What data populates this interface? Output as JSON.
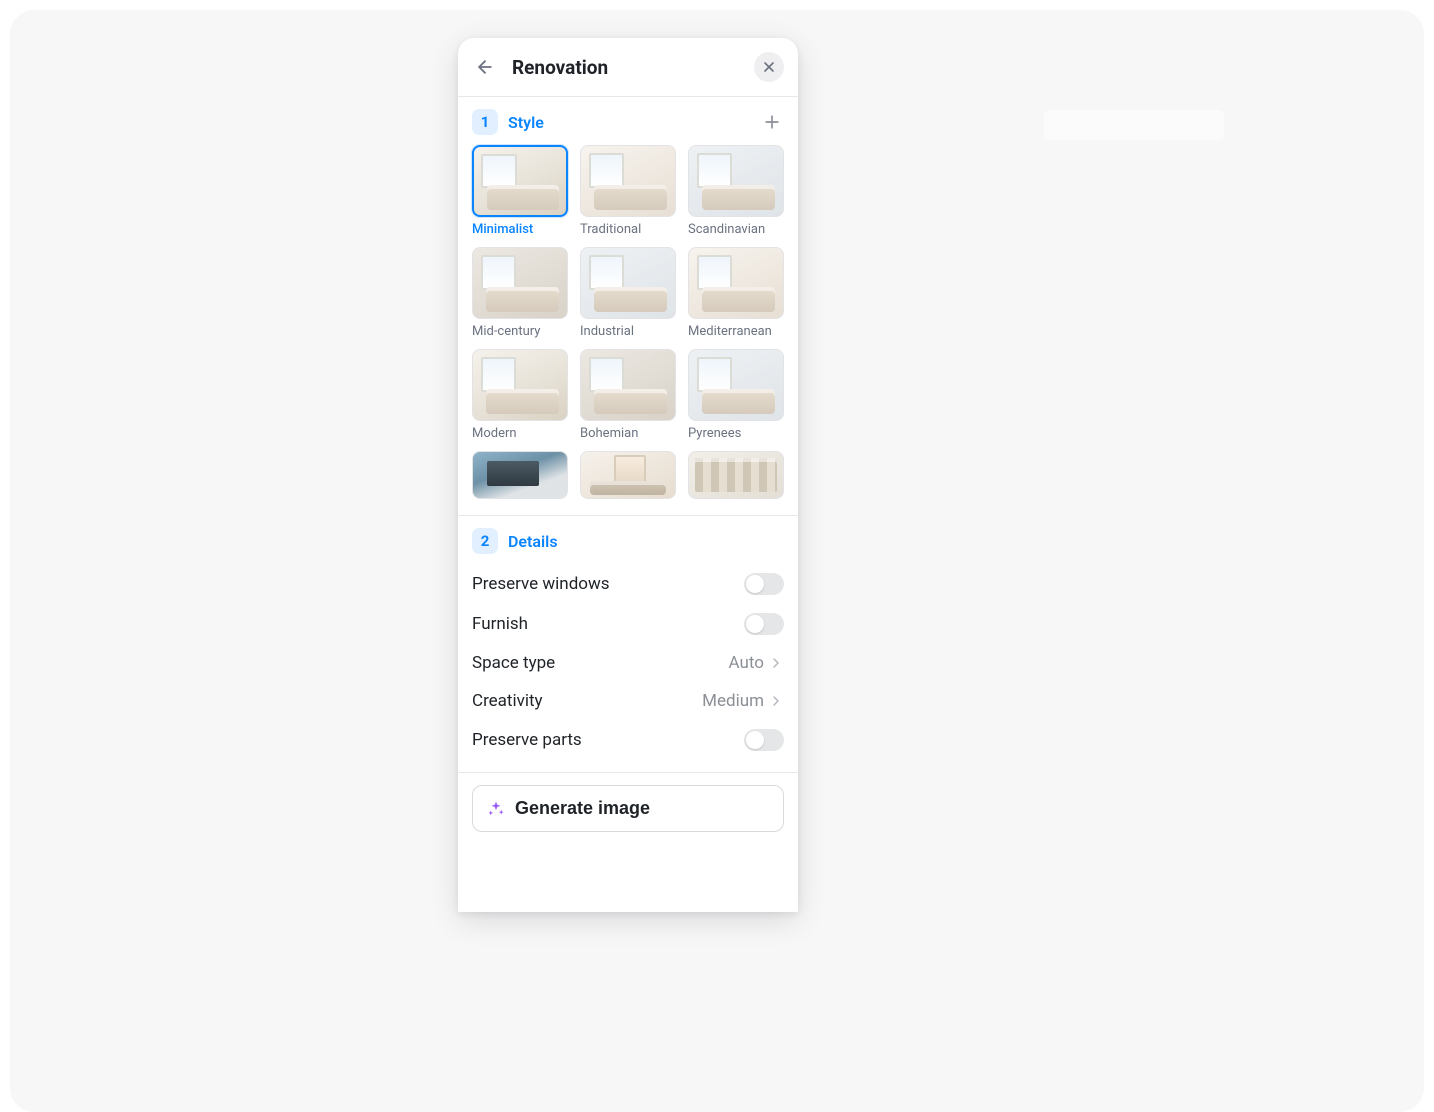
{
  "header": {
    "title": "Renovation"
  },
  "style_section": {
    "step": "1",
    "title": "Style",
    "selected": "Minimalist",
    "styles": [
      {
        "label": "Minimalist",
        "selected": true
      },
      {
        "label": "Traditional",
        "selected": false
      },
      {
        "label": "Scandinavian",
        "selected": false
      },
      {
        "label": "Mid-century",
        "selected": false
      },
      {
        "label": "Industrial",
        "selected": false
      },
      {
        "label": "Mediterranean",
        "selected": false
      },
      {
        "label": "Modern",
        "selected": false
      },
      {
        "label": "Bohemian",
        "selected": false
      },
      {
        "label": "Pyrenees",
        "selected": false
      }
    ]
  },
  "details_section": {
    "step": "2",
    "title": "Details",
    "rows": {
      "preserve_windows": {
        "label": "Preserve windows",
        "value": false,
        "type": "toggle"
      },
      "furnish": {
        "label": "Furnish",
        "value": false,
        "type": "toggle"
      },
      "space_type": {
        "label": "Space type",
        "value": "Auto",
        "type": "select"
      },
      "creativity": {
        "label": "Creativity",
        "value": "Medium",
        "type": "select"
      },
      "preserve_parts": {
        "label": "Preserve parts",
        "value": false,
        "type": "toggle"
      }
    }
  },
  "generate": {
    "label": "Generate image"
  }
}
